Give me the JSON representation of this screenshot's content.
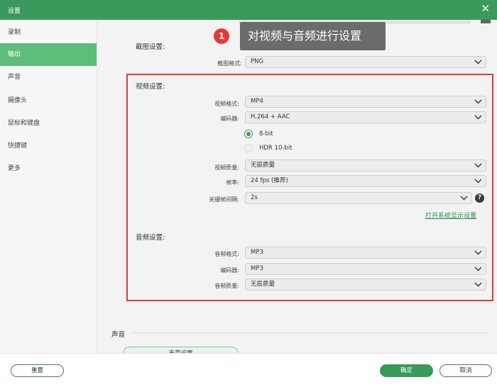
{
  "window": {
    "title": "设置",
    "close_icon": "close-icon"
  },
  "sidebar": {
    "items": [
      {
        "label": "录制"
      },
      {
        "label": "输出"
      },
      {
        "label": "声音"
      },
      {
        "label": "摄像头"
      },
      {
        "label": "鼠标和键盘"
      },
      {
        "label": "快捷键"
      },
      {
        "label": "更多"
      }
    ],
    "active_index": 1
  },
  "callout": {
    "number": "1",
    "text": "对视频与音频进行设置"
  },
  "screenshot": {
    "section_title": "截图设置:",
    "format_label": "截图格式:",
    "format_value": "PNG"
  },
  "video": {
    "section_title": "视频设置:",
    "format_label": "视频格式:",
    "format_value": "MP4",
    "encoder_label": "编码器:",
    "encoder_value": "H.264 + AAC",
    "bit_options": [
      {
        "label": "8-bit",
        "selected": true
      },
      {
        "label": "HDR 10-bit",
        "selected": false
      }
    ],
    "quality_label": "视频质量:",
    "quality_value": "无损质量",
    "framerate_label": "帧率:",
    "framerate_value": "24 fps (推荐)",
    "keyframe_label": "关键帧间隔:",
    "keyframe_value": "2s",
    "display_settings_link": "打开系统显示设置"
  },
  "audio": {
    "section_title": "音频设置:",
    "format_label": "音频格式:",
    "format_value": "MP3",
    "encoder_label": "编码器:",
    "encoder_value": "MP3",
    "quality_label": "音频质量:",
    "quality_value": "无损质量"
  },
  "sound_section": {
    "title": "声音",
    "button_label": "声音设置"
  },
  "footer": {
    "reset_label": "重置",
    "ok_label": "确定",
    "cancel_label": "取消"
  },
  "colors": {
    "accent": "#3a9a5b",
    "active_nav": "#5ebd7b",
    "highlight": "#e23b3b",
    "callout_bg": "#6b6b6b",
    "badge": "#e53935"
  }
}
